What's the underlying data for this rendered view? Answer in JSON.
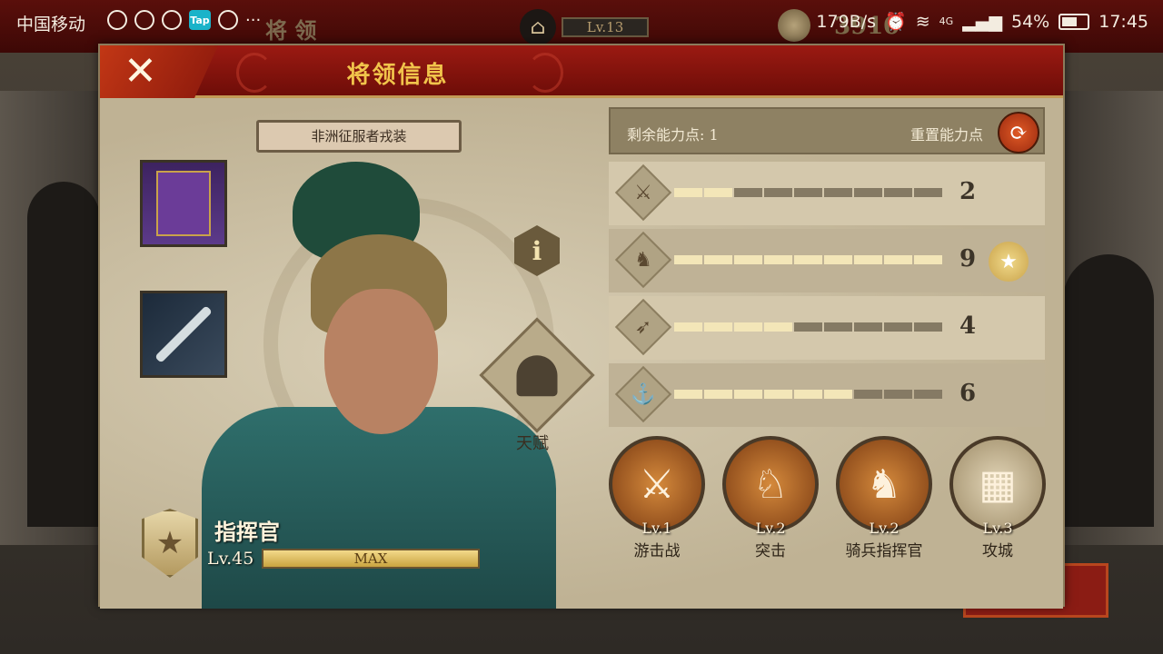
{
  "status_bar": {
    "carrier": "中国移动",
    "tap_label": "Tap",
    "more": "···",
    "net_speed": "179B/s",
    "signal": "4G",
    "battery": "54%",
    "time": "17:45"
  },
  "game_header": {
    "title_bg": "将 领",
    "level": "Lv.13",
    "gold": "3910"
  },
  "panel": {
    "title": "将领信息",
    "outfit_name": "非洲征服者戎装",
    "talent_label": "天赋",
    "rank_title": "指挥官",
    "level": "Lv.45",
    "exp_label": "MAX"
  },
  "stats": {
    "remaining_points_label": "剩余能力点: 1",
    "reset_label": "重置能力点",
    "segments_total": 9,
    "rows": [
      {
        "icon": "sword-icon",
        "glyph": "⚔",
        "value": 2
      },
      {
        "icon": "horse-icon",
        "glyph": "♞",
        "value": 9,
        "max_badge": true
      },
      {
        "icon": "bow-icon",
        "glyph": "➶",
        "value": 4
      },
      {
        "icon": "anchor-icon",
        "glyph": "⚓",
        "value": 6
      }
    ]
  },
  "skills": [
    {
      "level": "Lv.1",
      "name": "游击战",
      "style": "brown",
      "glyph": "⚔"
    },
    {
      "level": "Lv.2",
      "name": "突击",
      "style": "brown",
      "glyph": "♘"
    },
    {
      "level": "Lv.2",
      "name": "骑兵指挥官",
      "style": "brown",
      "glyph": "♞"
    },
    {
      "level": "Lv.3",
      "name": "攻城",
      "style": "pale",
      "glyph": "▦"
    }
  ],
  "colors": {
    "header_red": "#9b1a12",
    "title_gold": "#f1c44b",
    "bar_on": "#f3e6b8",
    "bar_off": "#857a64"
  }
}
